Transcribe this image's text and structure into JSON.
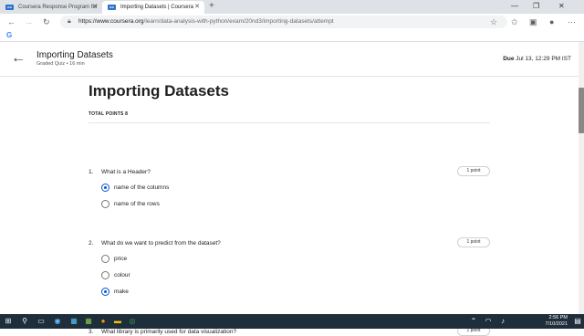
{
  "browser": {
    "tabs": [
      {
        "label": "Coursera Response Program for"
      },
      {
        "label": "Importing Datasets | Coursera"
      }
    ],
    "url_host": "https://www.coursera.org",
    "url_path": "/learn/data-analysis-with-python/exam/20nd3/importing-datasets/attempt",
    "icons": [
      "back-icon",
      "forward-icon",
      "refresh-icon",
      "lock-icon",
      "star-icon",
      "favorites-icon",
      "collections-icon",
      "profile-icon",
      "more-icon"
    ]
  },
  "quiz_header": {
    "title": "Importing Datasets",
    "subtitle": "Graded Quiz • 16 min",
    "due_label": "Due",
    "due_date": "Jul 13, 12:29 PM IST"
  },
  "main": {
    "title": "Importing Datasets",
    "total_points": "TOTAL POINTS 8",
    "questions": [
      {
        "number": "1.",
        "text": "What is a Header?",
        "points": "1 point",
        "options": [
          {
            "label": "name of the columns",
            "checked": true
          },
          {
            "label": "name of the rows",
            "checked": false
          }
        ]
      },
      {
        "number": "2.",
        "text": "What do we want to predict from the dataset?",
        "points": "1 point",
        "options": [
          {
            "label": "price",
            "checked": false
          },
          {
            "label": "colour",
            "checked": false
          },
          {
            "label": "make",
            "checked": true
          }
        ]
      },
      {
        "number": "3.",
        "text": "What library is primarily used for data visualization?",
        "points": "1 point",
        "options": []
      }
    ]
  },
  "taskbar": {
    "time": "2:56 PM",
    "date": "7/10/2021"
  },
  "colors": {
    "accent": "#0056d2",
    "taskbar": "#1e2e3b"
  }
}
